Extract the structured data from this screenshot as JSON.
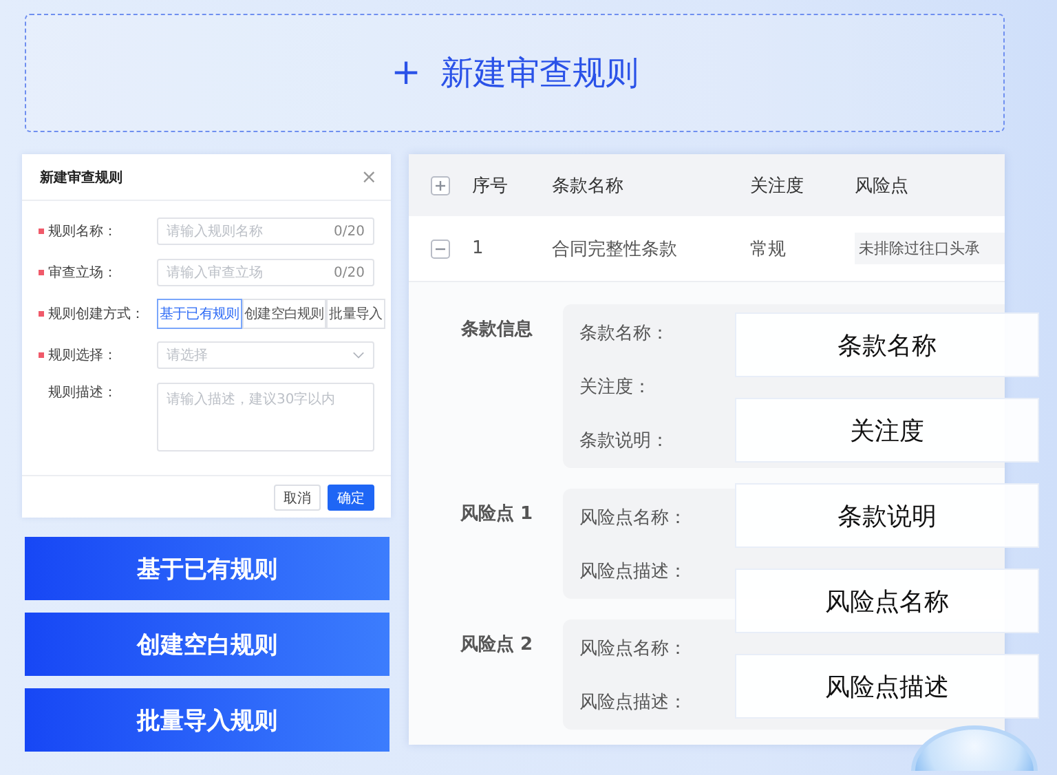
{
  "add_rule_button": {
    "icon": "+",
    "label": "新建审查规则"
  },
  "dialog": {
    "title": "新建审查规则",
    "close": "×",
    "fields": [
      {
        "kind": "text",
        "label": "规则名称：",
        "required": true,
        "placeholder": "请输入规则名称",
        "counter": "0/20"
      },
      {
        "kind": "text",
        "label": "审查立场：",
        "required": true,
        "placeholder": "请输入审查立场",
        "counter": "0/20"
      },
      {
        "kind": "segmented",
        "label": "规则创建方式：",
        "required": true,
        "options": [
          {
            "label": "基于已有规则",
            "selected": true
          },
          {
            "label": "创建空白规则",
            "selected": false
          },
          {
            "label": "批量导入",
            "selected": false
          }
        ]
      },
      {
        "kind": "select",
        "label": "规则选择：",
        "required": true,
        "placeholder": "请选择"
      },
      {
        "kind": "textarea",
        "label": "规则描述：",
        "required": false,
        "placeholder": "请输入描述，建议30字以内"
      }
    ],
    "buttons": [
      {
        "label": "取消",
        "primary": false
      },
      {
        "label": "确定",
        "primary": true
      }
    ]
  },
  "mode_buttons": [
    "基于已有规则",
    "创建空白规则",
    "批量导入规则"
  ],
  "table": {
    "columns": [
      "序号",
      "条款名称",
      "关注度",
      "风险点"
    ],
    "rows": [
      {
        "expanded": true,
        "cells": [
          "1",
          "合同完整性条款",
          "常规",
          "未排除过往口头承"
        ]
      }
    ],
    "groups": [
      {
        "title": "条款信息",
        "fields": [
          "条款名称：",
          "关注度：",
          "条款说明："
        ]
      },
      {
        "title": "风险点 1",
        "fields": [
          "风险点名称：",
          "风险点描述："
        ]
      },
      {
        "title": "风险点 2",
        "fields": [
          "风险点名称：",
          "风险点描述："
        ]
      }
    ]
  },
  "overlay_tags": [
    "条款名称",
    "关注度",
    "条款说明",
    "风险点名称",
    "风险点描述"
  ]
}
